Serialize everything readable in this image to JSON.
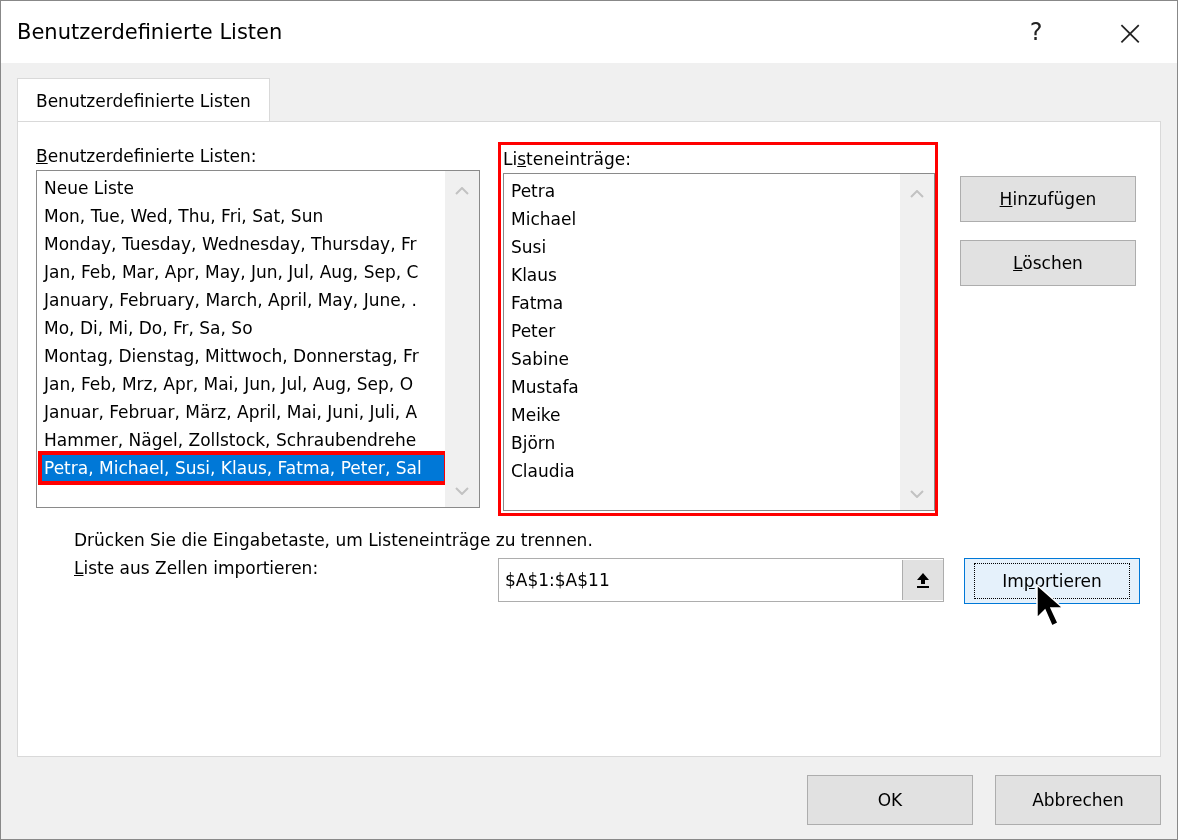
{
  "window": {
    "title": "Benutzerdefinierte Listen",
    "help": "?",
    "close": "×"
  },
  "tabs": [
    {
      "label": "Benutzerdefinierte Listen",
      "selected": true
    }
  ],
  "lists": {
    "label": {
      "key": "B",
      "after": "enutzerdefinierte Listen:"
    },
    "items": [
      {
        "text": "Neue Liste",
        "selected": false,
        "highlighted": false
      },
      {
        "text": "Mon, Tue, Wed, Thu, Fri, Sat, Sun",
        "selected": false,
        "highlighted": false
      },
      {
        "text": "Monday, Tuesday, Wednesday, Thursday, Fr",
        "selected": false,
        "highlighted": false
      },
      {
        "text": "Jan, Feb, Mar, Apr, May, Jun, Jul, Aug, Sep, C",
        "selected": false,
        "highlighted": false
      },
      {
        "text": "January, February, March, April, May, June, .",
        "selected": false,
        "highlighted": false
      },
      {
        "text": "Mo, Di, Mi, Do, Fr, Sa, So",
        "selected": false,
        "highlighted": false
      },
      {
        "text": "Montag, Dienstag, Mittwoch, Donnerstag, Fr",
        "selected": false,
        "highlighted": false
      },
      {
        "text": "Jan, Feb, Mrz, Apr, Mai, Jun, Jul, Aug, Sep, O",
        "selected": false,
        "highlighted": false
      },
      {
        "text": "Januar, Februar, März, April, Mai, Juni, Juli, A",
        "selected": false,
        "highlighted": false
      },
      {
        "text": "Hammer, Nägel, Zollstock, Schraubendrehe",
        "selected": false,
        "highlighted": false
      },
      {
        "text": "Petra, Michael, Susi, Klaus, Fatma, Peter, Sal",
        "selected": true,
        "highlighted": true
      }
    ]
  },
  "entries": {
    "label": {
      "before": "Li",
      "key": "s",
      "after": "teneinträge:"
    },
    "highlighted": true,
    "items": [
      "Petra",
      "Michael",
      "Susi",
      "Klaus",
      "Fatma",
      "Peter",
      "Sabine",
      "Mustafa",
      "Meike",
      "Björn",
      "Claudia"
    ]
  },
  "side_buttons": [
    {
      "key": "H",
      "after": "inzufügen"
    },
    {
      "key": "L",
      "after": "öschen"
    }
  ],
  "hint": "Drücken Sie die Eingabetaste, um Listeneinträge zu trennen.",
  "import": {
    "label": {
      "key": "L",
      "after": "iste aus Zellen importieren:"
    },
    "value": "$A$1:$A$11",
    "button": {
      "before": "Im",
      "key": "p",
      "after": "ortieren"
    },
    "focused": true
  },
  "footer_buttons": [
    "OK",
    "Abbrechen"
  ]
}
